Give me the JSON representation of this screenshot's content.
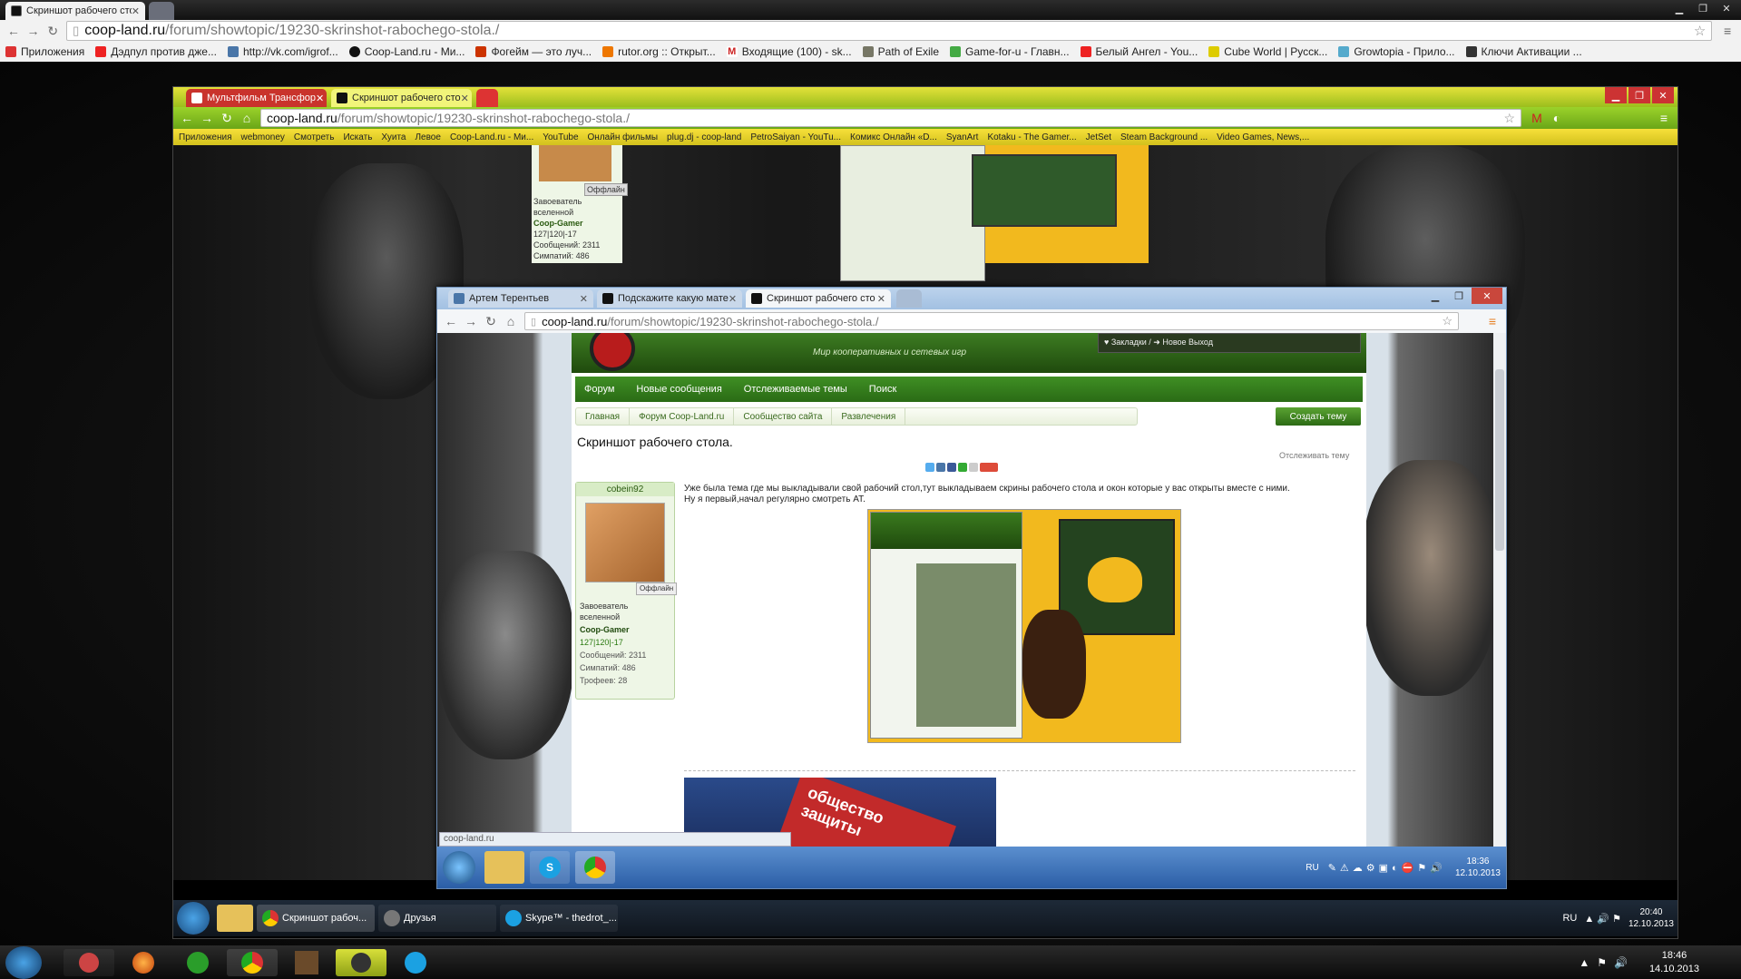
{
  "outer_browser": {
    "tabs": [
      {
        "label": "Скриншот рабочего стол",
        "active": true
      },
      {
        "label": "",
        "active": false
      }
    ],
    "url_host": "coop-land.ru",
    "url_path": "/forum/showtopic/19230-skrinshot-rabochego-stola./",
    "bookmarks": [
      "Приложения",
      "Дэдпул против дже...",
      "http://vk.com/igrof...",
      "Coop-Land.ru - Ми...",
      "Фогейм — это луч...",
      "rutor.org :: Открыт...",
      "Входящие (100) - sk...",
      "Path of Exile",
      "Game-for-u - Главн...",
      "Белый Ангел - You...",
      "Cube World | Русск...",
      "Growtopia - Прило...",
      "Ключи Активации ..."
    ]
  },
  "mid_browser": {
    "tabs": [
      {
        "label": "Мультфильм Трансфор",
        "active": false
      },
      {
        "label": "Скриншот рабочего сто",
        "active": true
      }
    ],
    "url_host": "coop-land.ru",
    "url_path": "/forum/showtopic/19230-skrinshot-rabochego-stola./",
    "bookmarks": [
      "Приложения",
      "webmoney",
      "Смотреть",
      "Искать",
      "Хуита",
      "Левое",
      "Coop-Land.ru - Ми...",
      "YouTube",
      "Онлайн фильмы",
      "plug.dj - coop-land",
      "PetroSaiyan - YouTu...",
      "Комикс Онлайн «D...",
      "SyanArt",
      "Kotaku - The Gamer...",
      "JetSet",
      "Steam Background ...",
      "Video Games, News,..."
    ],
    "sidebar_user": {
      "rank": "Завоеватель вселенной",
      "group": "Coop-Gamer",
      "rep": "127|120|-17",
      "posts": "Сообщений: 2311",
      "likes": "Симпатий: 486",
      "offline": "Оффлайн"
    }
  },
  "inner_browser": {
    "tabs": [
      {
        "label": "Артем Терентьев",
        "active": false
      },
      {
        "label": "Подскажите какую мате",
        "active": false
      },
      {
        "label": "Скриншот рабочего сто",
        "active": true
      }
    ],
    "url_host": "coop-land.ru",
    "url_path": "/forum/showtopic/19230-skrinshot-rabochego-stola./",
    "site_slogan": "Мир кооперативных и сетевых игр",
    "header_links": "♥ Закладки / ➜ Новое   Выход",
    "nav": [
      "Форум",
      "Новые сообщения",
      "Отслеживаемые темы",
      "Поиск"
    ],
    "breadcrumbs": [
      "Главная",
      "Форум Coop-Land.ru",
      "Сообщество сайта",
      "Развлечения"
    ],
    "create_topic": "Создать тему",
    "topic_title": "Скриншот рабочего стола.",
    "follow": "Отслеживать тему",
    "post": {
      "author": "cobein92",
      "offline": "Оффлайн",
      "rank": "Завоеватель вселенной",
      "group": "Coop-Gamer",
      "rep": "127|120|-17",
      "posts": "Сообщений: 2311",
      "likes": "Симпатий: 486",
      "trophies": "Трофеев: 28",
      "text_line1": "Уже была тема где мы выкладывали свой рабочий стол,тут выкладываем скрины рабочего стола и окон которые у вас открыты вместе с ними.",
      "text_line2": "Ну я первый,начал регулярно смотреть AT."
    },
    "banner_text": "общество защиты",
    "status_url": "coop-land.ru"
  },
  "inner_taskbar": {
    "lang": "RU",
    "time": "18:36",
    "date": "12.10.2013"
  },
  "mid_taskbar": {
    "items": [
      "Скриншот рабоч...",
      "Друзья",
      "Skype™ - thedrot_..."
    ],
    "lang": "RU",
    "time": "20:40",
    "date": "12.10.2013"
  },
  "outer_taskbar": {
    "time": "18:46",
    "date": "14.10.2013"
  },
  "colors": {
    "green_nav": "#2f7a1a",
    "jake_yellow": "#f2b91e",
    "win7_taskbar": "#1d5a96"
  }
}
